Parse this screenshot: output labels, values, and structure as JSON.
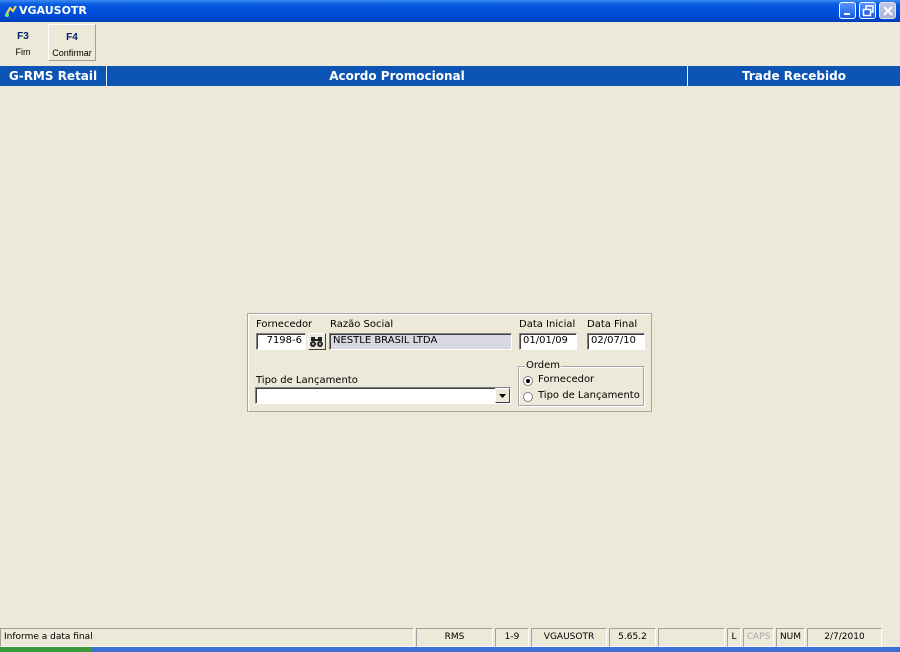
{
  "window": {
    "title": "VGAUSOTR",
    "app_icon": "app-icon"
  },
  "toolbar": {
    "buttons": [
      {
        "key": "F3",
        "label": "Fim"
      },
      {
        "key": "F4",
        "label": "Confirmar"
      }
    ]
  },
  "header": {
    "left": "G-RMS Retail",
    "center": "Acordo Promocional",
    "right": "Trade Recebido",
    "color": "#0d55b4"
  },
  "form": {
    "fornecedor_label": "Fornecedor",
    "fornecedor_value": "7198-6",
    "razao_social_label": "Razão Social",
    "razao_social_value": "NESTLE BRASIL LTDA",
    "data_inicial_label": "Data Inicial",
    "data_inicial_value": "01/01/09",
    "data_final_label": "Data Final",
    "data_final_value": "02/07/10",
    "tipo_lancamento_label": "Tipo de Lançamento",
    "tipo_lancamento_value": "",
    "ordem": {
      "legend": "Ordem",
      "options": [
        {
          "label": "Fornecedor",
          "selected": true
        },
        {
          "label": "Tipo de Lançamento",
          "selected": false
        }
      ]
    }
  },
  "statusbar": {
    "message": "Informe a data final",
    "system": "RMS",
    "code": "1-9",
    "program": "VGAUSOTR",
    "version": "5.65.2",
    "blank": "",
    "lock": "L",
    "caps": "CAPS",
    "num": "NUM",
    "date": "2/7/2010"
  }
}
